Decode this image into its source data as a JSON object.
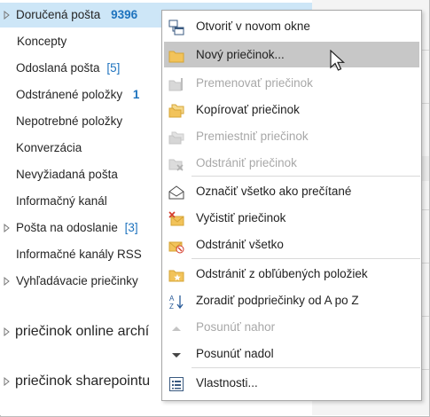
{
  "folders": [
    {
      "name": "Doručená pošta",
      "count": "9396",
      "count_style": "strong"
    },
    {
      "name": "Koncepty"
    },
    {
      "name": "Odoslaná pošta",
      "count": "[5]"
    },
    {
      "name": "Odstránené položky",
      "count": "1",
      "count_style": "strong"
    },
    {
      "name": "Nepotrebné položky"
    },
    {
      "name": "Konverzácia"
    },
    {
      "name": "Nevyžiadaná pošta"
    },
    {
      "name": "Informačný kanál"
    },
    {
      "name": "Pošta na odoslanie",
      "count": "[3]"
    },
    {
      "name": "Informačné kanály RSS"
    },
    {
      "name": "Vyhľadávacie priečinky"
    },
    {
      "name": "priečinok online archí"
    },
    {
      "name": "priečinok sharepointu"
    }
  ],
  "context_menu": {
    "items": [
      {
        "label": "Otvoriť v novom okne",
        "icon": "new-window-icon",
        "state": "enabled"
      },
      {
        "label": "Nový priečinok...",
        "icon": "new-folder-icon",
        "state": "hover"
      },
      {
        "label": "Premenovať priečinok",
        "icon": "rename-folder-icon",
        "state": "disabled"
      },
      {
        "label": "Kopírovať priečinok",
        "icon": "copy-folder-icon",
        "state": "enabled"
      },
      {
        "label": "Premiestniť priečinok",
        "icon": "move-folder-icon",
        "state": "disabled"
      },
      {
        "label": "Odstrániť priečinok",
        "icon": "delete-folder-icon",
        "state": "disabled"
      },
      {
        "label": "Označiť všetko ako prečítané",
        "icon": "mark-read-icon",
        "state": "enabled"
      },
      {
        "label": "Vyčistiť priečinok",
        "icon": "clean-up-icon",
        "state": "enabled"
      },
      {
        "label": "Odstrániť všetko",
        "icon": "delete-all-icon",
        "state": "enabled"
      },
      {
        "label": "Odstrániť z obľúbených položiek",
        "icon": "favorite-remove-icon",
        "state": "enabled"
      },
      {
        "label": "Zoradiť podpriečinky od A po Z",
        "icon": "sort-az-icon",
        "state": "enabled"
      },
      {
        "label": "Posunúť nahor",
        "icon": "arrow-up-icon",
        "state": "disabled"
      },
      {
        "label": "Posunúť nadol",
        "icon": "arrow-down-icon",
        "state": "enabled"
      },
      {
        "label": "Vlastnosti...",
        "icon": "properties-icon",
        "state": "enabled"
      }
    ]
  },
  "colors": {
    "selected_row": "#cde6f7",
    "count_blue": "#1e73be",
    "menu_hover": "#c7c7c7",
    "disabled_text": "#a8a8a8"
  }
}
